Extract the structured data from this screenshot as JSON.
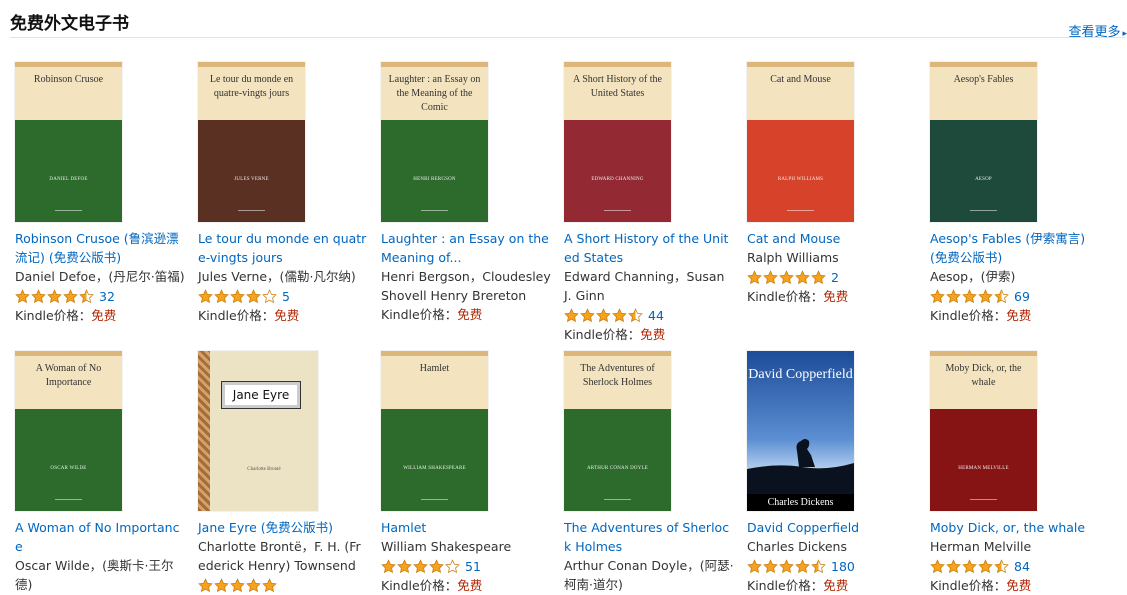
{
  "header": {
    "title": "免费外文电子书",
    "see_more": "查看更多"
  },
  "colors": {
    "link": "#0066c0",
    "free": "#b12704",
    "star": "#f7a21e"
  },
  "books": [
    {
      "cover_title": "Robinson Crusoe",
      "cover_author": "Daniel Defoe",
      "band": "#2c6b2b",
      "title": "Robinson Crusoe (鲁滨逊漂流记) (免费公版书)",
      "author": "Daniel Defoe，(丹尼尔·笛福)",
      "rating": 4.5,
      "count": "32",
      "price_label": "Kindle价格：",
      "price": "免费"
    },
    {
      "cover_title": "Le tour du monde en quatre-vingts jours",
      "cover_author": "Jules Verne",
      "band": "#5a3022",
      "title": "Le tour du monde en quatre-vingts jours",
      "author": "Jules Verne，(儒勒·凡尔纳)",
      "rating": 4,
      "count": "5",
      "price_label": "Kindle价格：",
      "price": "免费"
    },
    {
      "cover_title": "Laughter : an Essay on the Meaning of the Comic",
      "cover_author": "Henri Bergson",
      "band": "#2c6b2b",
      "title": "Laughter : an Essay on the Meaning of...",
      "author": "Henri Bergson，Cloudesley Shovell Henry Brereton",
      "rating": null,
      "count": "",
      "price_label": "Kindle价格：",
      "price": "免费"
    },
    {
      "cover_title": "A Short History of the United States",
      "cover_author": "Edward Channing",
      "band": "#932a33",
      "title": "A Short History of the United States",
      "author": "Edward Channing，Susan J. Ginn",
      "rating": 4.5,
      "count": "44",
      "price_label": "Kindle价格：",
      "price": "免费"
    },
    {
      "cover_title": "Cat and Mouse",
      "cover_author": "Ralph Williams",
      "band": "#d6432a",
      "title": "Cat and Mouse",
      "author": "Ralph Williams",
      "rating": 5,
      "count": "2",
      "price_label": "Kindle价格：",
      "price": "免费"
    },
    {
      "cover_title": "Aesop's Fables",
      "cover_author": "Aesop",
      "band": "#1d4a3a",
      "title": "Aesop's Fables (伊索寓言) (免费公版书)",
      "author": "Aesop，(伊索)",
      "rating": 4.5,
      "count": "69",
      "price_label": "Kindle价格：",
      "price": "免费"
    },
    {
      "cover_title": "A Woman of No Importance",
      "cover_author": "Oscar Wilde",
      "band": "#2c6b2b",
      "title": "A Woman of No Importance",
      "author": "Oscar Wilde，(奥斯卡·王尔德)",
      "rating": null,
      "count": "",
      "price_label": "",
      "price": ""
    },
    {
      "cover_title": "Jane Eyre",
      "cover_author": "Charlotte Brontë",
      "band": "",
      "title": "Jane Eyre (免费公版书)",
      "author": "Charlotte Brontë，F. H. (Frederick Henry) Townsend",
      "rating": 5,
      "count": "",
      "price_label": "",
      "price": "",
      "special": "jane"
    },
    {
      "cover_title": "Hamlet",
      "cover_author": "William Shakespeare",
      "band": "#2c6b2b",
      "title": "Hamlet",
      "author": "William Shakespeare",
      "rating": 4,
      "count": "51",
      "price_label": "Kindle价格：",
      "price": "免费"
    },
    {
      "cover_title": "The Adventures of Sherlock Holmes",
      "cover_author": "Arthur Conan Doyle",
      "band": "#2c6b2b",
      "title": "The Adventures of Sherlock Holmes",
      "author": "Arthur Conan Doyle，(阿瑟·柯南·道尔)",
      "rating": null,
      "count": "",
      "price_label": "",
      "price": ""
    },
    {
      "cover_title": "David Copperfield",
      "cover_author": "Charles Dickens",
      "band": "",
      "title": "David Copperfield",
      "author": "Charles Dickens",
      "rating": 4.5,
      "count": "180",
      "price_label": "Kindle价格：",
      "price": "免费",
      "special": "david"
    },
    {
      "cover_title": "Moby Dick, or, the whale",
      "cover_author": "Herman Melville",
      "band": "#861414",
      "title": "Moby Dick, or, the whale",
      "author": "Herman Melville",
      "rating": 4.5,
      "count": "84",
      "price_label": "Kindle价格：",
      "price": "免费"
    }
  ]
}
